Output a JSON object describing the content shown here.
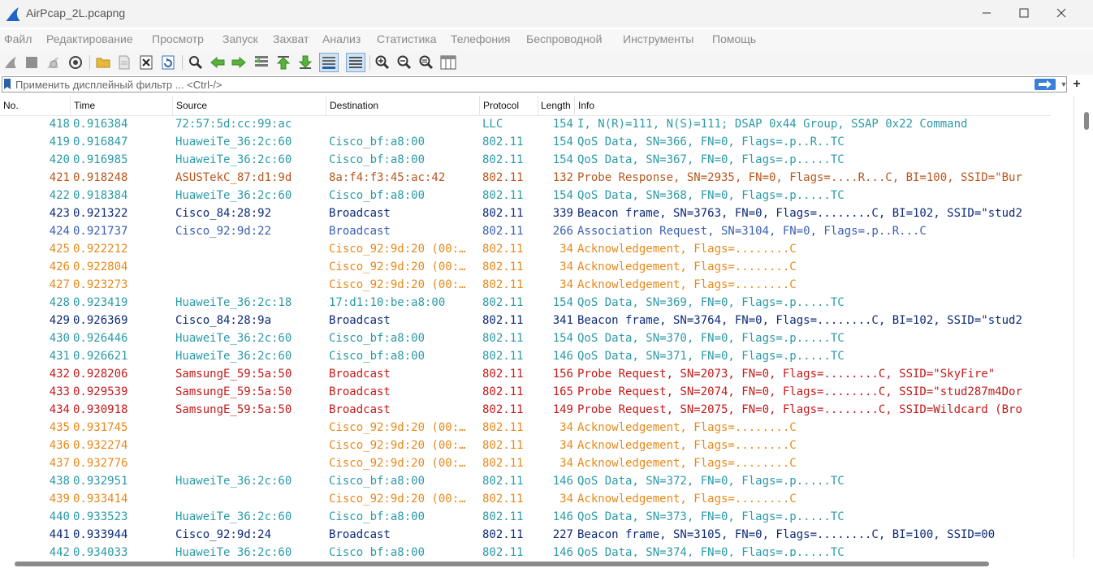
{
  "window": {
    "title": "AirPcap_2L.pcapng"
  },
  "menu": [
    "Файл",
    "Редактирование",
    "Просмотр",
    "Запуск",
    "Захват",
    "Анализ",
    "Статистика",
    "Телефония",
    "Беспроводной",
    "Инструменты",
    "Помощь"
  ],
  "filter": {
    "placeholder": "Применить дисплейный фильтр ... <Ctrl-/>"
  },
  "columns": [
    "No.",
    "Time",
    "Source",
    "Destination",
    "Protocol",
    "Length",
    "Info"
  ],
  "colors": {
    "teal": "#2b9aa6",
    "orange": "#e8891a",
    "brown": "#b8561b",
    "navy": "#0d2a7a",
    "blue": "#3a5fb0",
    "red": "#c41a1a"
  },
  "packets": [
    {
      "no": "418",
      "time": "0.916384",
      "src": "72:57:5d:cc:99:ac",
      "dst": "",
      "proto": "LLC",
      "len": "154",
      "info": "I, N(R)=111, N(S)=111; DSAP 0x44 Group, SSAP 0x22 Command",
      "color": "teal"
    },
    {
      "no": "419",
      "time": "0.916847",
      "src": "HuaweiTe_36:2c:60",
      "dst": "Cisco_bf:a8:00",
      "proto": "802.11",
      "len": "154",
      "info": "QoS Data, SN=366, FN=0, Flags=.p..R..TC",
      "color": "teal"
    },
    {
      "no": "420",
      "time": "0.916985",
      "src": "HuaweiTe_36:2c:60",
      "dst": "Cisco_bf:a8:00",
      "proto": "802.11",
      "len": "154",
      "info": "QoS Data, SN=367, FN=0, Flags=.p.....TC",
      "color": "teal"
    },
    {
      "no": "421",
      "time": "0.918248",
      "src": "ASUSTekC_87:d1:9d",
      "dst": "8a:f4:f3:45:ac:42",
      "proto": "802.11",
      "len": "132",
      "info": "Probe Response, SN=2935, FN=0, Flags=....R...C, BI=100, SSID=\"Bur",
      "color": "brown"
    },
    {
      "no": "422",
      "time": "0.918384",
      "src": "HuaweiTe_36:2c:60",
      "dst": "Cisco_bf:a8:00",
      "proto": "802.11",
      "len": "154",
      "info": "QoS Data, SN=368, FN=0, Flags=.p.....TC",
      "color": "teal"
    },
    {
      "no": "423",
      "time": "0.921322",
      "src": "Cisco_84:28:92",
      "dst": "Broadcast",
      "proto": "802.11",
      "len": "339",
      "info": "Beacon frame, SN=3763, FN=0, Flags=........C, BI=102, SSID=\"stud2",
      "color": "navy"
    },
    {
      "no": "424",
      "time": "0.921737",
      "src": "Cisco_92:9d:22",
      "dst": "Broadcast",
      "proto": "802.11",
      "len": "266",
      "info": "Association Request, SN=3104, FN=0, Flags=.p..R...C",
      "color": "blue"
    },
    {
      "no": "425",
      "time": "0.922212",
      "src": "",
      "dst": "Cisco_92:9d:20 (00:…",
      "proto": "802.11",
      "len": "34",
      "info": "Acknowledgement, Flags=........C",
      "color": "orange"
    },
    {
      "no": "426",
      "time": "0.922804",
      "src": "",
      "dst": "Cisco_92:9d:20 (00:…",
      "proto": "802.11",
      "len": "34",
      "info": "Acknowledgement, Flags=........C",
      "color": "orange"
    },
    {
      "no": "427",
      "time": "0.923273",
      "src": "",
      "dst": "Cisco_92:9d:20 (00:…",
      "proto": "802.11",
      "len": "34",
      "info": "Acknowledgement, Flags=........C",
      "color": "orange"
    },
    {
      "no": "428",
      "time": "0.923419",
      "src": "HuaweiTe_36:2c:18",
      "dst": "17:d1:10:be:a8:00",
      "proto": "802.11",
      "len": "154",
      "info": "QoS Data, SN=369, FN=0, Flags=.p.....TC",
      "color": "teal"
    },
    {
      "no": "429",
      "time": "0.926369",
      "src": "Cisco_84:28:9a",
      "dst": "Broadcast",
      "proto": "802.11",
      "len": "341",
      "info": "Beacon frame, SN=3764, FN=0, Flags=........C, BI=102, SSID=\"stud2",
      "color": "navy"
    },
    {
      "no": "430",
      "time": "0.926446",
      "src": "HuaweiTe_36:2c:60",
      "dst": "Cisco_bf:a8:00",
      "proto": "802.11",
      "len": "154",
      "info": "QoS Data, SN=370, FN=0, Flags=.p.....TC",
      "color": "teal"
    },
    {
      "no": "431",
      "time": "0.926621",
      "src": "HuaweiTe_36:2c:60",
      "dst": "Cisco_bf:a8:00",
      "proto": "802.11",
      "len": "146",
      "info": "QoS Data, SN=371, FN=0, Flags=.p.....TC",
      "color": "teal"
    },
    {
      "no": "432",
      "time": "0.928206",
      "src": "SamsungE_59:5a:50",
      "dst": "Broadcast",
      "proto": "802.11",
      "len": "156",
      "info": "Probe Request, SN=2073, FN=0, Flags=........C, SSID=\"SkyFire\"",
      "color": "red"
    },
    {
      "no": "433",
      "time": "0.929539",
      "src": "SamsungE_59:5a:50",
      "dst": "Broadcast",
      "proto": "802.11",
      "len": "165",
      "info": "Probe Request, SN=2074, FN=0, Flags=........C, SSID=\"stud287m4Dor",
      "color": "red"
    },
    {
      "no": "434",
      "time": "0.930918",
      "src": "SamsungE_59:5a:50",
      "dst": "Broadcast",
      "proto": "802.11",
      "len": "149",
      "info": "Probe Request, SN=2075, FN=0, Flags=........C, SSID=Wildcard (Bro",
      "color": "red"
    },
    {
      "no": "435",
      "time": "0.931745",
      "src": "",
      "dst": "Cisco_92:9d:20 (00:…",
      "proto": "802.11",
      "len": "34",
      "info": "Acknowledgement, Flags=........C",
      "color": "orange"
    },
    {
      "no": "436",
      "time": "0.932274",
      "src": "",
      "dst": "Cisco_92:9d:20 (00:…",
      "proto": "802.11",
      "len": "34",
      "info": "Acknowledgement, Flags=........C",
      "color": "orange"
    },
    {
      "no": "437",
      "time": "0.932776",
      "src": "",
      "dst": "Cisco_92:9d:20 (00:…",
      "proto": "802.11",
      "len": "34",
      "info": "Acknowledgement, Flags=........C",
      "color": "orange"
    },
    {
      "no": "438",
      "time": "0.932951",
      "src": "HuaweiTe_36:2c:60",
      "dst": "Cisco_bf:a8:00",
      "proto": "802.11",
      "len": "146",
      "info": "QoS Data, SN=372, FN=0, Flags=.p.....TC",
      "color": "teal"
    },
    {
      "no": "439",
      "time": "0.933414",
      "src": "",
      "dst": "Cisco_92:9d:20 (00:…",
      "proto": "802.11",
      "len": "34",
      "info": "Acknowledgement, Flags=........C",
      "color": "orange"
    },
    {
      "no": "440",
      "time": "0.933523",
      "src": "HuaweiTe_36:2c:60",
      "dst": "Cisco_bf:a8:00",
      "proto": "802.11",
      "len": "146",
      "info": "QoS Data, SN=373, FN=0, Flags=.p.....TC",
      "color": "teal"
    },
    {
      "no": "441",
      "time": "0.933944",
      "src": "Cisco_92:9d:24",
      "dst": "Broadcast",
      "proto": "802.11",
      "len": "227",
      "info": "Beacon frame, SN=3105, FN=0, Flags=........C, BI=100, SSID=00",
      "color": "navy"
    },
    {
      "no": "442",
      "time": "0.934033",
      "src": "HuaweiTe_36:2c:60",
      "dst": "Cisco_bf:a8:00",
      "proto": "802.11",
      "len": "146",
      "info": "QoS Data, SN=374, FN=0, Flags=.p.....TC",
      "color": "teal"
    }
  ]
}
